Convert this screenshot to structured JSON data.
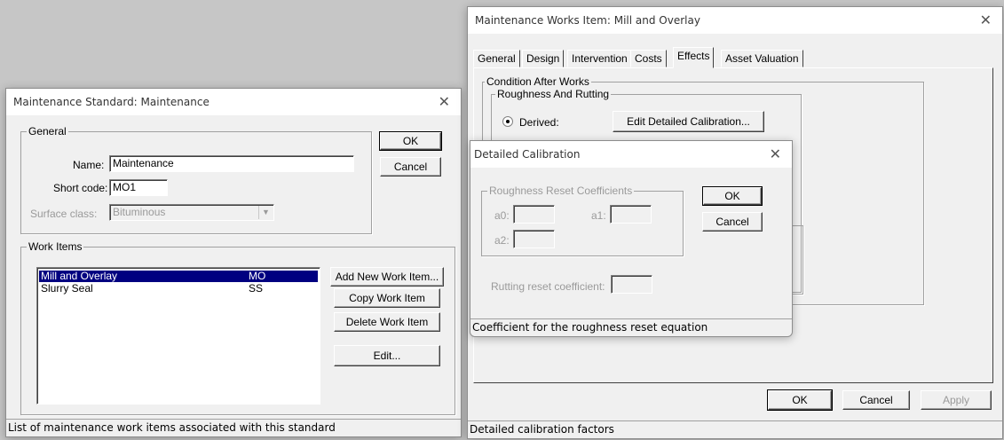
{
  "maint_standard": {
    "title": "Maintenance Standard: Maintenance",
    "close_glyph": "✕",
    "general_legend": "General",
    "name_label": "Name:",
    "name_value": "Maintenance",
    "short_code_label": "Short code:",
    "short_code_value": "MO1",
    "surface_class_label": "Surface class:",
    "surface_class_value": "Bituminous",
    "ok_label": "OK",
    "cancel_label": "Cancel",
    "work_items_legend": "Work Items",
    "work_items": [
      {
        "name": "Mill and Overlay",
        "code": "MO"
      },
      {
        "name": "Slurry Seal",
        "code": "SS"
      }
    ],
    "add_new_label": "Add New Work Item...",
    "copy_label": "Copy Work Item",
    "delete_label": "Delete Work Item",
    "edit_label": "Edit...",
    "status_text": "List of maintenance work items associated with this standard"
  },
  "works_item": {
    "title": "Maintenance Works Item: Mill and Overlay",
    "close_glyph": "✕",
    "tabs": [
      "General",
      "Design",
      "Intervention",
      "Costs",
      "Effects",
      "Asset Valuation"
    ],
    "active_tab": "Effects",
    "condition_legend": "Condition After Works",
    "roughness_legend": "Roughness And Rutting",
    "derived_label": "Derived:",
    "edit_calibration_label": "Edit Detailed Calibration...",
    "ok_label": "OK",
    "cancel_label": "Cancel",
    "apply_label": "Apply",
    "status_text": "Detailed calibration factors"
  },
  "calibration": {
    "title": "Detailed Calibration",
    "close_glyph": "✕",
    "reset_legend": "Roughness Reset Coefficients",
    "a0_label": "a0:",
    "a1_label": "a1:",
    "a2_label": "a2:",
    "ok_label": "OK",
    "cancel_label": "Cancel",
    "rutting_label": "Rutting reset coefficient:",
    "status_text": "Coefficient for the roughness reset equation"
  },
  "icons": {
    "dropdown": "chevron-down-icon",
    "radio": "radio-selected-icon"
  }
}
